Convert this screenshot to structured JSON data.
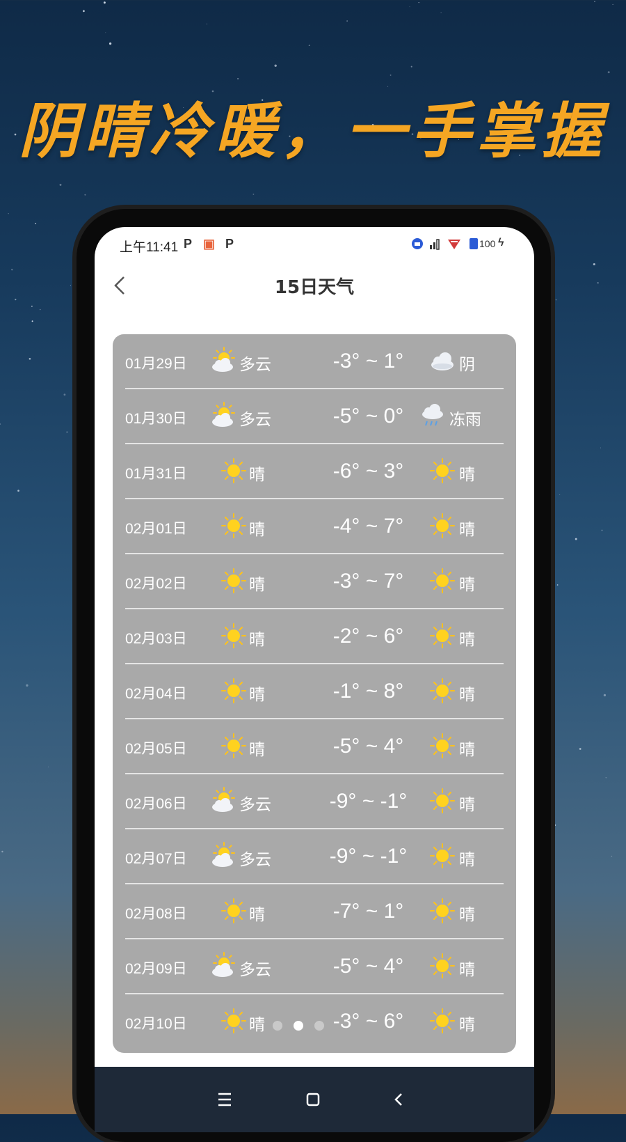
{
  "headline": "阴晴冷暖，一手掌握",
  "status_bar": {
    "time": "上午11:41",
    "left_icons": [
      "P",
      "▣",
      "P"
    ],
    "battery": "100"
  },
  "header": {
    "title": "15日天气",
    "back_label": "<"
  },
  "colors": {
    "accent": "#f5a623",
    "card": "#a9a9a9",
    "navbar": "#1e2938"
  },
  "forecast": [
    {
      "date": "01月29日",
      "day_icon": "partly-cloudy-icon",
      "day_text": "多云",
      "temp": "-3° ~ 1°",
      "night_icon": "overcast-icon",
      "night_text": "阴"
    },
    {
      "date": "01月30日",
      "day_icon": "partly-cloudy-icon",
      "day_text": "多云",
      "temp": "-5° ~ 0°",
      "night_icon": "freezing-rain-icon",
      "night_text": "冻雨"
    },
    {
      "date": "01月31日",
      "day_icon": "sunny-icon",
      "day_text": "晴",
      "temp": "-6° ~ 3°",
      "night_icon": "sunny-icon",
      "night_text": "晴"
    },
    {
      "date": "02月01日",
      "day_icon": "sunny-icon",
      "day_text": "晴",
      "temp": "-4° ~ 7°",
      "night_icon": "sunny-icon",
      "night_text": "晴"
    },
    {
      "date": "02月02日",
      "day_icon": "sunny-icon",
      "day_text": "晴",
      "temp": "-3° ~ 7°",
      "night_icon": "sunny-icon",
      "night_text": "晴"
    },
    {
      "date": "02月03日",
      "day_icon": "sunny-icon",
      "day_text": "晴",
      "temp": "-2° ~ 6°",
      "night_icon": "sunny-icon",
      "night_text": "晴"
    },
    {
      "date": "02月04日",
      "day_icon": "sunny-icon",
      "day_text": "晴",
      "temp": "-1° ~ 8°",
      "night_icon": "sunny-icon",
      "night_text": "晴"
    },
    {
      "date": "02月05日",
      "day_icon": "sunny-icon",
      "day_text": "晴",
      "temp": "-5° ~ 4°",
      "night_icon": "sunny-icon",
      "night_text": "晴"
    },
    {
      "date": "02月06日",
      "day_icon": "partly-cloudy-icon",
      "day_text": "多云",
      "temp": "-9° ~ -1°",
      "night_icon": "sunny-icon",
      "night_text": "晴"
    },
    {
      "date": "02月07日",
      "day_icon": "partly-cloudy-icon",
      "day_text": "多云",
      "temp": "-9° ~ -1°",
      "night_icon": "sunny-icon",
      "night_text": "晴"
    },
    {
      "date": "02月08日",
      "day_icon": "sunny-icon",
      "day_text": "晴",
      "temp": "-7° ~ 1°",
      "night_icon": "sunny-icon",
      "night_text": "晴"
    },
    {
      "date": "02月09日",
      "day_icon": "partly-cloudy-icon",
      "day_text": "多云",
      "temp": "-5° ~ 4°",
      "night_icon": "sunny-icon",
      "night_text": "晴"
    },
    {
      "date": "02月10日",
      "day_icon": "sunny-icon",
      "day_text": "晴",
      "temp": "-3° ~ 6°",
      "night_icon": "sunny-icon",
      "night_text": "晴"
    }
  ],
  "pager": {
    "count": 3,
    "active": 1
  },
  "navbar": {
    "buttons": [
      "menu-icon",
      "home-icon",
      "back-icon"
    ]
  }
}
